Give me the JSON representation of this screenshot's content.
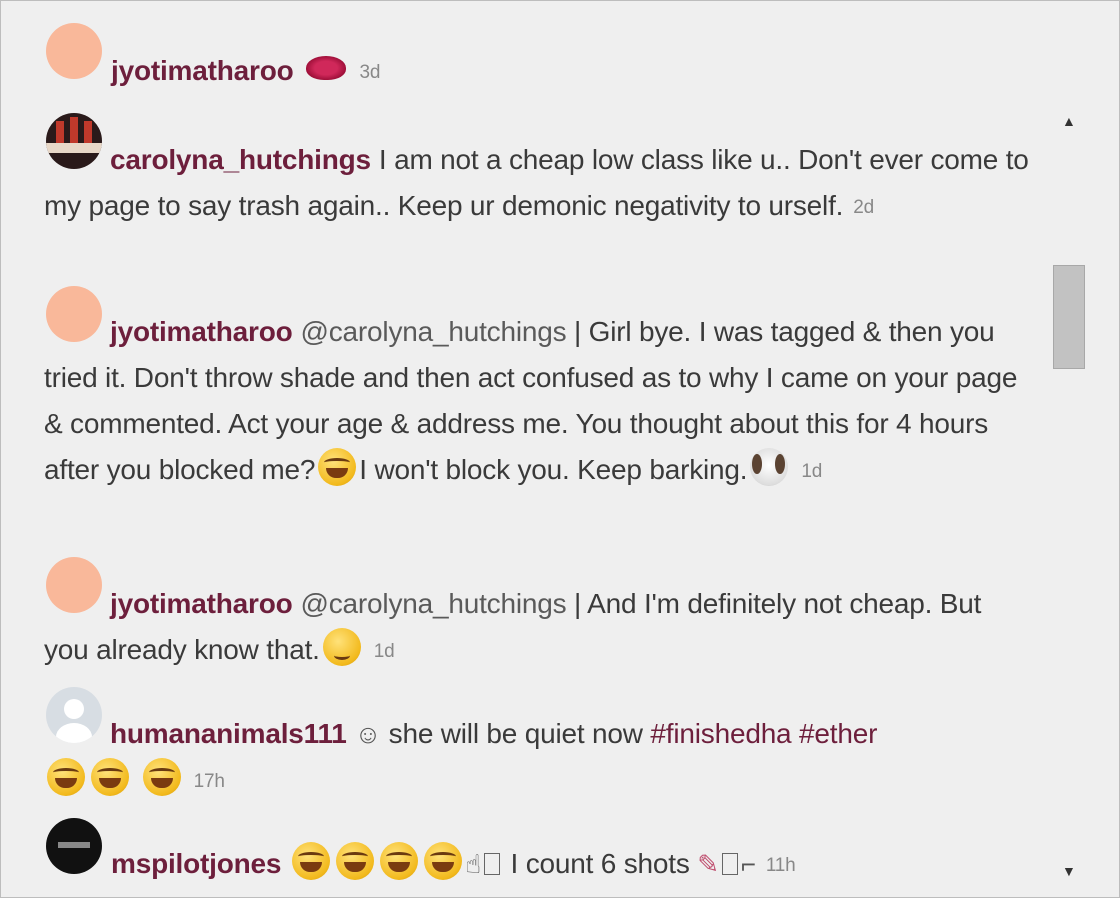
{
  "comments": [
    {
      "user": "jyotimatharoo",
      "text": "",
      "emoji": "kiss-mark",
      "time": "3d"
    },
    {
      "user": "carolyna_hutchings",
      "text": "I am not a cheap low class like u.. Don't ever come to my page to say trash again.. Keep ur demonic negativity to urself.",
      "time": "2d"
    },
    {
      "user": "jyotimatharoo",
      "mention": "@carolyna_hutchings",
      "text_a": "| Girl bye. I was tagged & then you tried it. Don't throw shade and then act confused as to why I came on your page & commented. Act your age & address me. You thought about this for 4 hours after you blocked me?",
      "text_b": "I won't block you. Keep barking.",
      "time": "1d"
    },
    {
      "user": "jyotimatharoo",
      "mention": "@carolyna_hutchings",
      "text": "| And I'm definitely not cheap. But you already know that.",
      "time": "1d"
    },
    {
      "user": "humananimals111",
      "text": "she will be quiet now",
      "tags": [
        "#finishedha",
        "#ether"
      ],
      "time": "17h"
    },
    {
      "user": "mspilotjones",
      "text": "I count 6 shots",
      "time": "11h"
    }
  ],
  "icons": {
    "scroll_up": "▲",
    "scroll_down": "▼",
    "hand": "☝",
    "gun": "🔫"
  },
  "colors": {
    "username": "#6d1f3c",
    "background": "#efefef"
  }
}
